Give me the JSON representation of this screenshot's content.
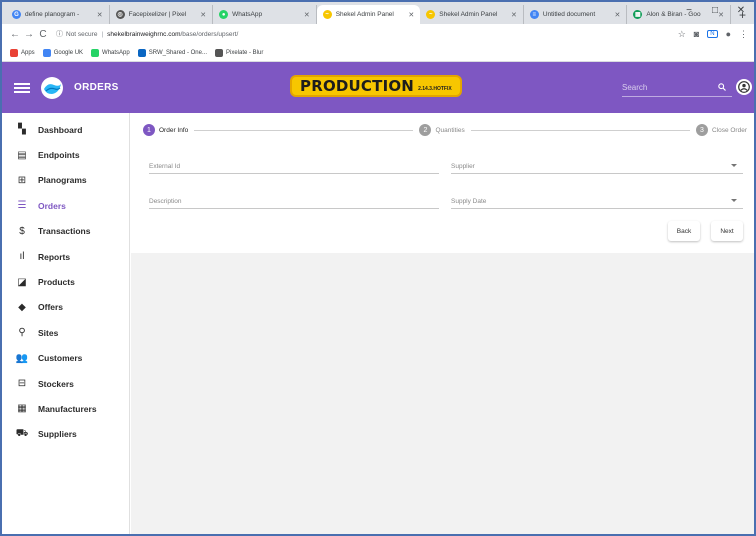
{
  "browser": {
    "tabs": [
      {
        "title": "define planogram -",
        "favicon_color": "#4285f4",
        "favicon_glyph": "G"
      },
      {
        "title": "Facepixelizer | Pixel",
        "favicon_color": "#555555",
        "favicon_glyph": "◎"
      },
      {
        "title": "WhatsApp",
        "favicon_color": "#25d366",
        "favicon_glyph": "●"
      },
      {
        "title": "Shekel Admin Panel",
        "favicon_color": "#f7c600",
        "favicon_glyph": "~",
        "active": true
      },
      {
        "title": "Shekel Admin Panel",
        "favicon_color": "#f7c600",
        "favicon_glyph": "~"
      },
      {
        "title": "Untitled document",
        "favicon_color": "#4285f4",
        "favicon_glyph": "≡"
      },
      {
        "title": "Alon & Biran - Goo",
        "favicon_color": "#0f9d58",
        "favicon_glyph": "▦"
      }
    ],
    "new_tab": "+",
    "window_controls": {
      "minimize": "−",
      "maximize": "□",
      "close": "✕"
    },
    "security_label": "Not secure",
    "url_host": "shekelbrainweighrnc.com",
    "url_path": "/base/orders/upsert/",
    "bookmarks": [
      {
        "label": "Apps",
        "color": "#e94235"
      },
      {
        "label": "Google UK",
        "color": "#4285f4"
      },
      {
        "label": "WhatsApp",
        "color": "#25d366"
      },
      {
        "label": "SRW_Shared - One...",
        "color": "#0a66c2"
      },
      {
        "label": "Pixelate - Blur",
        "color": "#555555"
      }
    ]
  },
  "header": {
    "title": "ORDERS",
    "env_badge": "PRODUCTION",
    "version": "2.14.3.HOTFIX",
    "search_placeholder": "Search"
  },
  "sidebar": {
    "items": [
      {
        "label": "Dashboard",
        "icon": "dashboard-icon",
        "glyph": "▚"
      },
      {
        "label": "Endpoints",
        "icon": "endpoints-icon",
        "glyph": "▤"
      },
      {
        "label": "Planograms",
        "icon": "grid-icon",
        "glyph": "⊞"
      },
      {
        "label": "Orders",
        "icon": "list-icon",
        "glyph": "☰",
        "active": true
      },
      {
        "label": "Transactions",
        "icon": "dollar-icon",
        "glyph": "$"
      },
      {
        "label": "Reports",
        "icon": "bar-chart-icon",
        "glyph": "ıl"
      },
      {
        "label": "Products",
        "icon": "products-icon",
        "glyph": "◪"
      },
      {
        "label": "Offers",
        "icon": "tag-icon",
        "glyph": "◆"
      },
      {
        "label": "Sites",
        "icon": "location-pin-icon",
        "glyph": "⚲"
      },
      {
        "label": "Customers",
        "icon": "people-icon",
        "glyph": "👥"
      },
      {
        "label": "Stockers",
        "icon": "bus-icon",
        "glyph": "⊟"
      },
      {
        "label": "Manufacturers",
        "icon": "building-icon",
        "glyph": "▦"
      },
      {
        "label": "Suppliers",
        "icon": "truck-icon",
        "glyph": "⛟"
      }
    ]
  },
  "stepper": {
    "steps": [
      {
        "num": "1",
        "label": "Order Info",
        "active": true
      },
      {
        "num": "2",
        "label": "Quantities"
      },
      {
        "num": "3",
        "label": "Close Order"
      }
    ]
  },
  "form": {
    "external_id_placeholder": "External Id",
    "supplier_placeholder": "Supplier",
    "description_placeholder": "Description",
    "supply_date_placeholder": "Supply Date",
    "back_label": "Back",
    "next_label": "Next"
  },
  "colors": {
    "accent": "#7e57c2",
    "badge": "#f7c600"
  }
}
